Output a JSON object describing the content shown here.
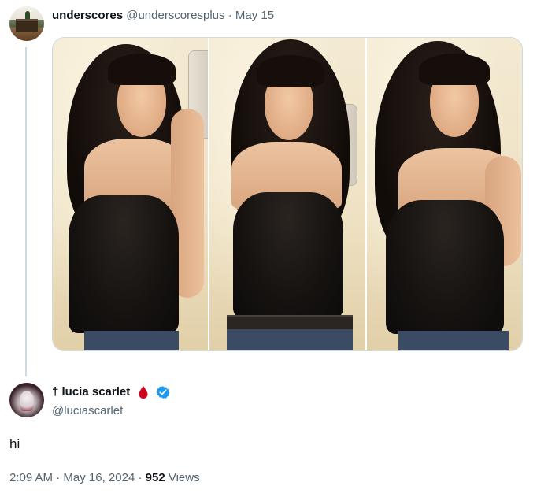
{
  "parent_tweet": {
    "display_name": "underscores",
    "handle": "@underscoresplus",
    "separator": "·",
    "date": "May 15",
    "photos": [
      "photo-1",
      "photo-2",
      "photo-3"
    ]
  },
  "reply_tweet": {
    "display_name": "† lucia scarlet",
    "handle": "@luciascarlet",
    "text": "hi",
    "time": "2:09 AM",
    "separator": "·",
    "date": "May 16, 2024",
    "views_count": "952",
    "views_label": "Views",
    "icons": [
      "blood-drop-icon",
      "verified-badge-icon"
    ]
  },
  "colors": {
    "text_primary": "#0f1419",
    "text_secondary": "#536471",
    "thread_line": "#cfd9de",
    "verified_blue": "#1d9bf0",
    "drop_red": "#d0021b"
  }
}
